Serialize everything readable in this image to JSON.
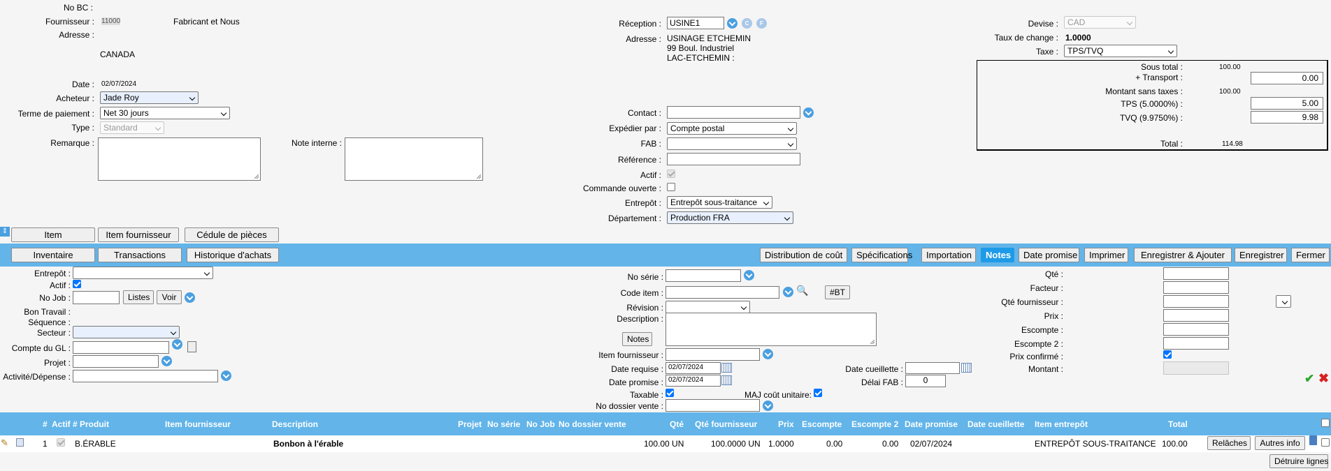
{
  "header": {
    "no_bc_label": "No BC :",
    "fournisseur_label": "Fournisseur :",
    "fournisseur_code": "11000",
    "fournisseur_name": "Fabricant et Nous",
    "adresse_label": "Adresse :",
    "country": "CANADA",
    "date_label": "Date :",
    "date_value": "02/07/2024",
    "acheteur_label": "Acheteur :",
    "acheteur_value": "Jade Roy",
    "terme_label": "Terme de paiement :",
    "terme_value": "Net 30 jours",
    "type_label": "Type :",
    "type_value": "Standard",
    "remarque_label": "Remarque :",
    "note_interne_label": "Note interne :"
  },
  "reception": {
    "reception_label": "Réception :",
    "reception_value": "USINE1",
    "icon_c": "C",
    "icon_f": "F",
    "adresse_label": "Adresse :",
    "adresse_line1": "USINAGE ETCHEMIN",
    "adresse_line2": "99 Boul. Industriel",
    "adresse_line3": "LAC-ETCHEMIN :",
    "contact_label": "Contact :",
    "expedier_label": "Expédier par :",
    "expedier_value": "Compte postal",
    "fab_label": "FAB :",
    "reference_label": "Référence :",
    "actif_label": "Actif :",
    "commande_ouverte_label": "Commande ouverte :",
    "entrepot_label": "Entrepôt :",
    "entrepot_value": "Entrepôt sous-traitance",
    "departement_label": "Département :",
    "departement_value": "Production FRA"
  },
  "totals": {
    "devise_label": "Devise :",
    "devise_value": "CAD",
    "taux_label": "Taux de change :",
    "taux_value": "1.0000",
    "taxe_label": "Taxe :",
    "taxe_value": "TPS/TVQ",
    "sous_total_label": "Sous total :",
    "sous_total_value": "100.00",
    "transport_label": "+ Transport :",
    "transport_value": "0.00",
    "montant_sans_taxes_label": "Montant sans taxes :",
    "montant_sans_taxes_value": "100.00",
    "tps_label": "TPS (5.0000%) :",
    "tps_value": "5.00",
    "tvq_label": "TVQ (9.9750%) :",
    "tvq_value": "9.98",
    "total_label": "Total :",
    "total_value": "114.98"
  },
  "tabs_top": [
    "Item",
    "Item fournisseur",
    "Cédule de pièces"
  ],
  "tabs_bar_left": [
    "Inventaire",
    "Transactions",
    "Historique d'achats"
  ],
  "tabs_bar_right": [
    "Distribution de coût",
    "Spécifications",
    "Importation",
    "Notes",
    "Date promise",
    "Imprimer",
    "Enregistrer & Ajouter",
    "Enregistrer",
    "Fermer"
  ],
  "line_form": {
    "entrepot_label": "Entrepôt :",
    "actif_label": "Actif :",
    "no_job_label": "No Job :",
    "listes_button": "Listes",
    "voir_button": "Voir",
    "bon_travail_label": "Bon Travail :",
    "sequence_label": "Séquence :",
    "secteur_label": "Secteur :",
    "compte_gl_label": "Compte du GL :",
    "projet_label": "Projet :",
    "activite_label": "Activité/Dépense :",
    "no_serie_label": "No série :",
    "code_item_label": "Code item :",
    "bt_button": "#BT",
    "revision_label": "Révision :",
    "description_label": "Description :",
    "notes_button": "Notes",
    "item_fournisseur_label": "Item fournisseur :",
    "date_requise_label": "Date requise :",
    "date_requise_value": "02/07/2024",
    "date_promise_label": "Date promise :",
    "date_promise_value": "02/07/2024",
    "taxable_label": "Taxable :",
    "no_dossier_label": "No dossier vente :",
    "date_cueillette_label": "Date cueillette :",
    "delai_fab_label": "Délai FAB :",
    "delai_fab_value": "0",
    "maj_cout_label": "MAJ coût unitaire:",
    "qte_label": "Qté :",
    "facteur_label": "Facteur :",
    "qte_fournisseur_label": "Qté fournisseur :",
    "prix_label": "Prix :",
    "escompte_label": "Escompte :",
    "escompte2_label": "Escompte 2 :",
    "prix_confirme_label": "Prix confirmé :",
    "montant_label": "Montant :"
  },
  "table": {
    "headers": {
      "num": "#",
      "actif": "Actif",
      "produit": "# Produit",
      "item_fournisseur": "Item fournisseur",
      "description": "Description",
      "projet": "Projet",
      "no_serie": "No série",
      "no_job": "No Job",
      "no_dossier": "No dossier vente",
      "qte": "Qté",
      "qte_fournisseur": "Qté fournisseur",
      "prix": "Prix",
      "escompte": "Escompte",
      "escompte2": "Escompte 2",
      "date_promise": "Date promise",
      "date_cueillette": "Date cueillette",
      "item_entrepot": "Item entrepôt",
      "total": "Total"
    },
    "row": {
      "num": "1",
      "produit": "B.ÉRABLE",
      "description": "Bonbon à l'érable",
      "qte": "100.00 UN",
      "qte_fournisseur": "100.0000 UN",
      "prix": "1.0000",
      "escompte": "0.00",
      "escompte2": "0.00",
      "date_promise": "02/07/2024",
      "item_entrepot": "ENTREPÔT SOUS-TRAITANCE",
      "total": "100.00",
      "relaches_button": "Relâches",
      "autres_button": "Autres info"
    },
    "detruire_button": "Détruire lignes"
  }
}
